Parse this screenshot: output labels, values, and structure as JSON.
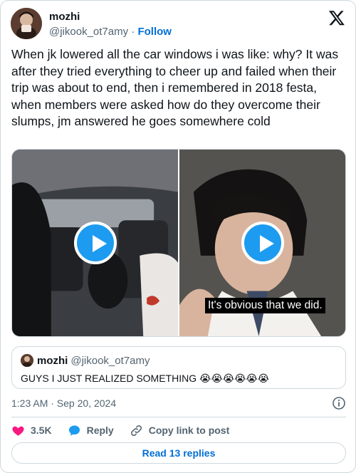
{
  "author": {
    "display_name": "mozhi",
    "handle": "@jikook_ot7amy",
    "separator": "·",
    "follow_label": "Follow"
  },
  "tweet": {
    "text": "When jk lowered all the car windows i was like: why? It was after they tried everything to cheer up and failed when their trip was about to end, then i remembered in 2018 festa, when members were asked how do they overcome their slumps, jm answered he goes somewhere cold"
  },
  "media": {
    "videos": [
      {
        "icon": "play-icon"
      },
      {
        "icon": "play-icon",
        "caption": "It's obvious that we did."
      }
    ]
  },
  "quote": {
    "display_name": "mozhi",
    "handle": "@jikook_ot7amy",
    "text": "GUYS I JUST REALIZED SOMETHING 😭😭😭😭😭😭"
  },
  "meta": {
    "timestamp": "1:23 AM · Sep 20, 2024"
  },
  "actions": {
    "like_count": "3.5K",
    "reply_label": "Reply",
    "copy_label": "Copy link to post"
  },
  "footer": {
    "read_replies_label": "Read 13 replies"
  },
  "colors": {
    "accent": "#1d9bf0",
    "link": "#006fd6",
    "like": "#f91880",
    "muted": "#536471",
    "border": "#cfd9de"
  }
}
